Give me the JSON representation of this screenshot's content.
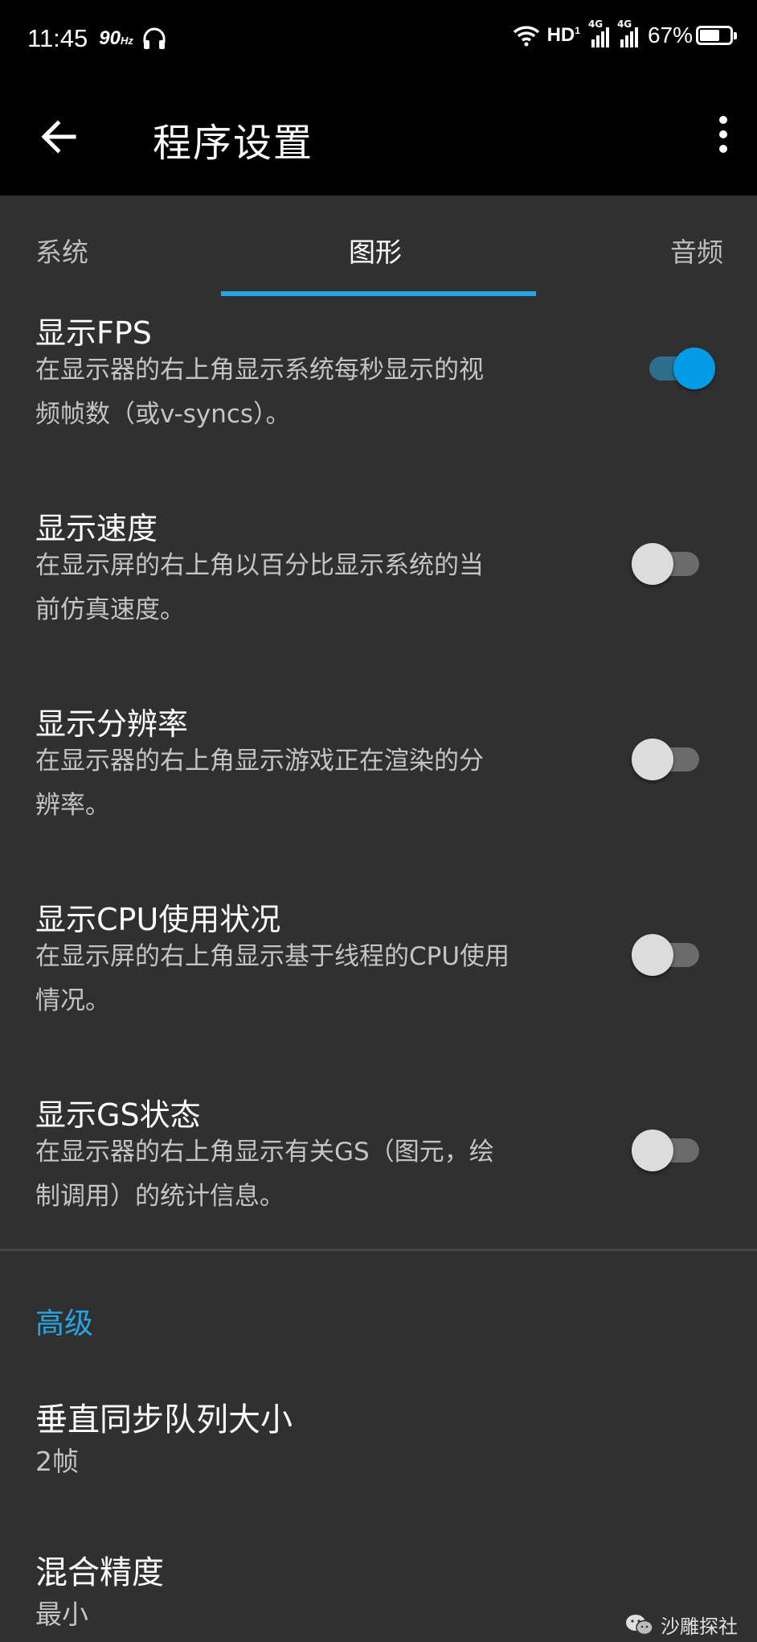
{
  "status_bar": {
    "time": "11:45",
    "refresh_rate": "90",
    "refresh_unit": "Hz",
    "hd_label": "HD",
    "hd_sup": "1",
    "network_1": "4G",
    "network_2": "4G",
    "battery_percent": "67%",
    "battery_level": 0.67
  },
  "toolbar": {
    "title": "程序设置",
    "back_icon": "arrow-left-icon",
    "more_icon": "more-vertical-icon"
  },
  "tabs": [
    {
      "label": "系统",
      "active": false
    },
    {
      "label": "图形",
      "active": true
    },
    {
      "label": "音频",
      "active": false
    }
  ],
  "settings": [
    {
      "title": "显示FPS",
      "desc_line1": "在显示器的右上角显示系统每秒显示的视",
      "desc_line2": "频帧数（或v-syncs）。",
      "enabled": true
    },
    {
      "title": "显示速度",
      "desc_line1": "在显示屏的右上角以百分比显示系统的当",
      "desc_line2": "前仿真速度。",
      "enabled": false
    },
    {
      "title": "显示分辨率",
      "desc_line1": "在显示器的右上角显示游戏正在渲染的分",
      "desc_line2": "辨率。",
      "enabled": false
    },
    {
      "title": "显示CPU使用状况",
      "desc_line1": "在显示屏的右上角显示基于线程的CPU使用",
      "desc_line2": "情况。",
      "enabled": false
    },
    {
      "title": "显示GS状态",
      "desc_line1": "在显示器的右上角显示有关GS（图元，绘",
      "desc_line2": "制调用）的统计信息。",
      "enabled": false
    }
  ],
  "advanced": {
    "header": "高级",
    "items": [
      {
        "title": "垂直同步队列大小",
        "value": "2帧"
      },
      {
        "title": "混合精度",
        "value": "最小"
      }
    ]
  },
  "watermark": {
    "text": "沙雕探社"
  },
  "colors": {
    "accent": "#29a4e3",
    "switch_on": "#039be5",
    "background": "#303030",
    "toolbar": "#000000"
  }
}
